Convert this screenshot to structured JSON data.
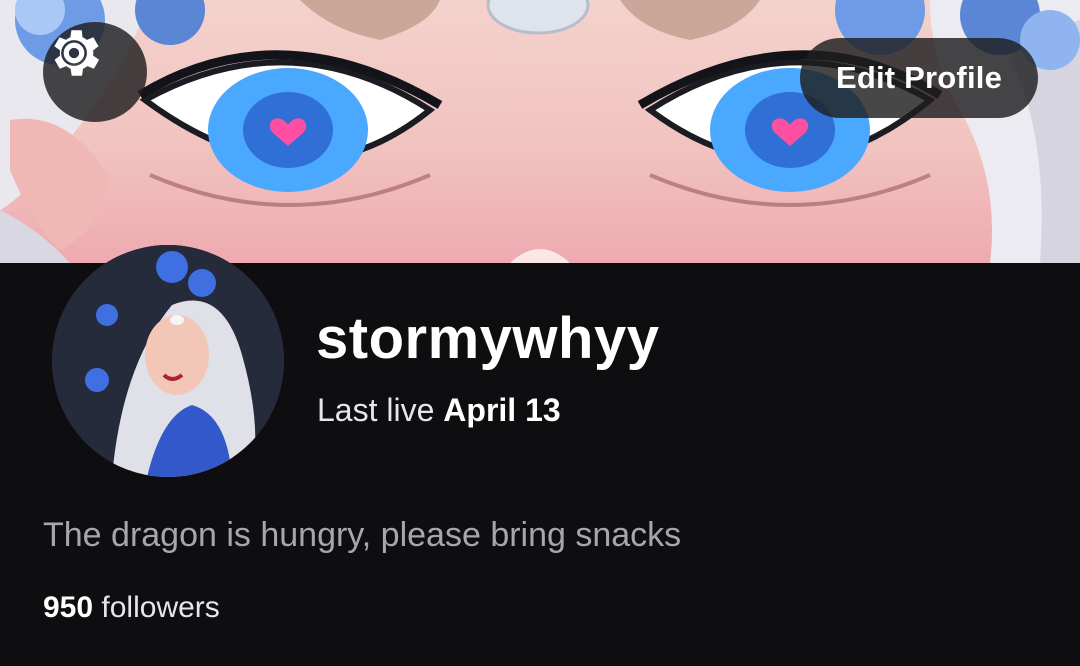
{
  "banner": {
    "description_icon": "banner-image"
  },
  "header": {
    "settings_icon": "gear-icon",
    "edit_profile_label": "Edit Profile"
  },
  "profile": {
    "username": "stormywhyy",
    "last_live_prefix": "Last live",
    "last_live_date": "April 13",
    "bio": "The dragon is hungry, please bring snacks",
    "followers_count": "950",
    "followers_label": "followers"
  },
  "colors": {
    "background": "#0e0e10",
    "button_bg": "#1e1e20",
    "text_primary": "#ffffff",
    "text_secondary": "#a6a6ad",
    "eye_blue": "#4aa8ff",
    "heart_pink": "#ff4fa3"
  }
}
